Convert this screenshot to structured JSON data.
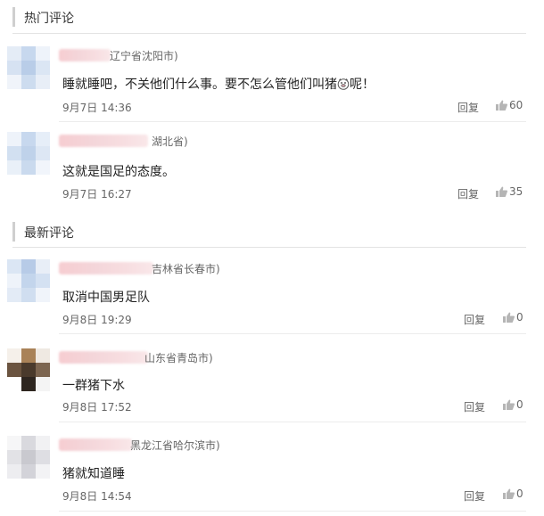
{
  "hot_section": {
    "title": "热门评论",
    "comments": [
      {
        "location": "辽宁省沈阳市)",
        "content_before": "睡就睡吧，不关他们什么事。要不怎么管他们叫猪",
        "content_after": "呢！",
        "time": "9月7日 14:36",
        "reply": "回复",
        "likes": "60"
      },
      {
        "location": "湖北省)",
        "content": "这就是国足的态度。",
        "time": "9月7日 16:27",
        "reply": "回复",
        "likes": "35"
      }
    ]
  },
  "new_section": {
    "title": "最新评论",
    "comments": [
      {
        "location": "吉林省长春市)",
        "content": "取消中国男足队",
        "time": "9月8日 19:29",
        "reply": "回复",
        "likes": "0"
      },
      {
        "location": "山东省青岛市)",
        "content": "一群猪下水",
        "time": "9月8日 17:52",
        "reply": "回复",
        "likes": "0"
      },
      {
        "location": "黑龙江省哈尔滨市)",
        "content": "猪就知道睡",
        "time": "9月8日 14:54",
        "reply": "回复",
        "likes": "0"
      }
    ]
  },
  "icons": {
    "like": "thumbs-up-icon",
    "pig_emoji": "pig-face-emoji-icon"
  },
  "colors": {
    "text": "#222222",
    "meta": "#666666",
    "like_icon": "#b5b5b5",
    "section_bar": "#cfcfcf",
    "name_blur": "#f6cdd1"
  }
}
